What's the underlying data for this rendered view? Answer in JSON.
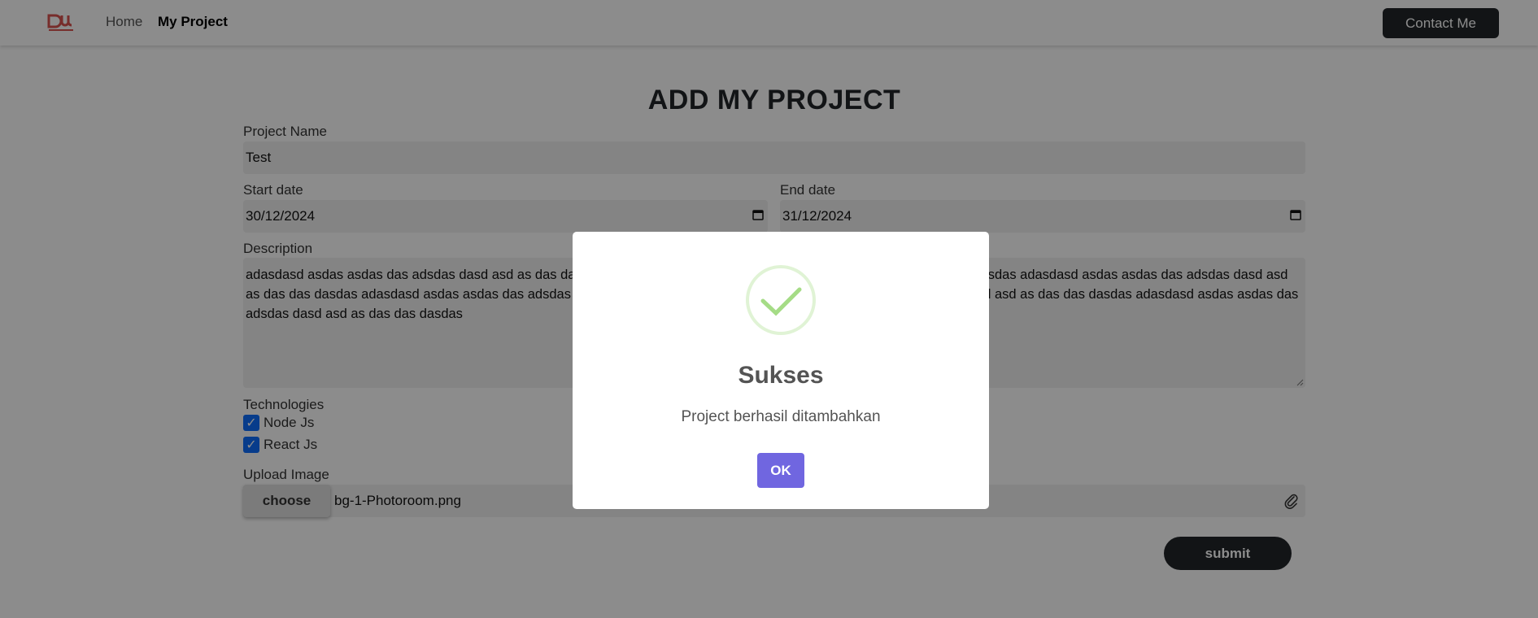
{
  "navbar": {
    "logo_text": "DW",
    "home_label": "Home",
    "project_label": "My Project",
    "contact_label": "Contact Me"
  },
  "form": {
    "title": "ADD MY PROJECT",
    "project_name_label": "Project Name",
    "project_name_value": "Test",
    "start_date_label": "Start date",
    "start_date_value": "30/12/2024",
    "end_date_label": "End date",
    "end_date_value": "31/12/2024",
    "description_label": "Description",
    "description_value": "adasdasd asdas asdas das adsdas dasd asd as das das dasdas adasdasd asdas asdas das adsdas dasd asd as das das dasdas adasdasd asdas asdas das adsdas dasd asd as das das dasdas adasdasd asdas asdas das adsdas dasd asd as das das dasdas adasdasd asdas asdas das adsdas dasd asd as das das dasdas adasdasd asdas asdas das adsdas dasd asd as das das dasdas",
    "technologies_label": "Technologies",
    "technologies": [
      {
        "label": "Node Js",
        "checked": true
      },
      {
        "label": "React Js",
        "checked": true
      }
    ],
    "upload_label": "Upload Image",
    "choose_label": "choose",
    "file_name": "bg-1-Photoroom.png",
    "submit_label": "submit"
  },
  "modal": {
    "title": "Sukses",
    "message": "Project berhasil ditambahkan",
    "ok_label": "OK",
    "success_color": "#a5dc86",
    "confirm_color": "#7066e0"
  }
}
